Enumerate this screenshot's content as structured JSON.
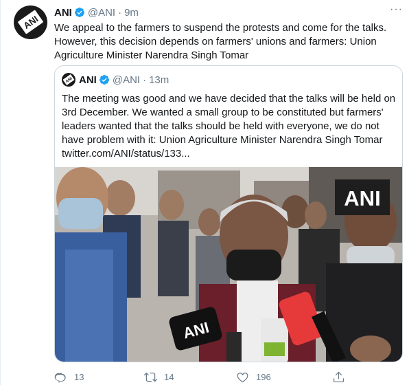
{
  "tweet": {
    "name": "ANI",
    "handle": "@ANI",
    "separator": "·",
    "time": "9m",
    "text": "We appeal to the farmers to suspend the protests and come for the talks. However, this decision depends on farmers' unions and farmers: Union Agriculture Minister Narendra Singh Tomar",
    "more_label": "···"
  },
  "quoted": {
    "name": "ANI",
    "handle": "@ANI",
    "separator": "·",
    "time": "13m",
    "text": "The meeting was good and we have decided that the talks will be held on 3rd December. We wanted a small group to be constituted but farmers' leaders wanted that the talks should be held with everyone, we do not have problem with it: Union Agriculture Minister Narendra Singh Tomar twitter.com/ANI/status/133...",
    "watermark": "ANI",
    "mic_label": "ANI"
  },
  "actions": {
    "replies": "13",
    "retweets": "14",
    "likes": "196"
  },
  "colors": {
    "verified": "#1da1f2",
    "muted": "#657786",
    "border": "#ccd6dd"
  },
  "icons": [
    "verified-badge-icon",
    "more-options-icon",
    "reply-icon",
    "retweet-icon",
    "like-icon",
    "share-icon"
  ]
}
